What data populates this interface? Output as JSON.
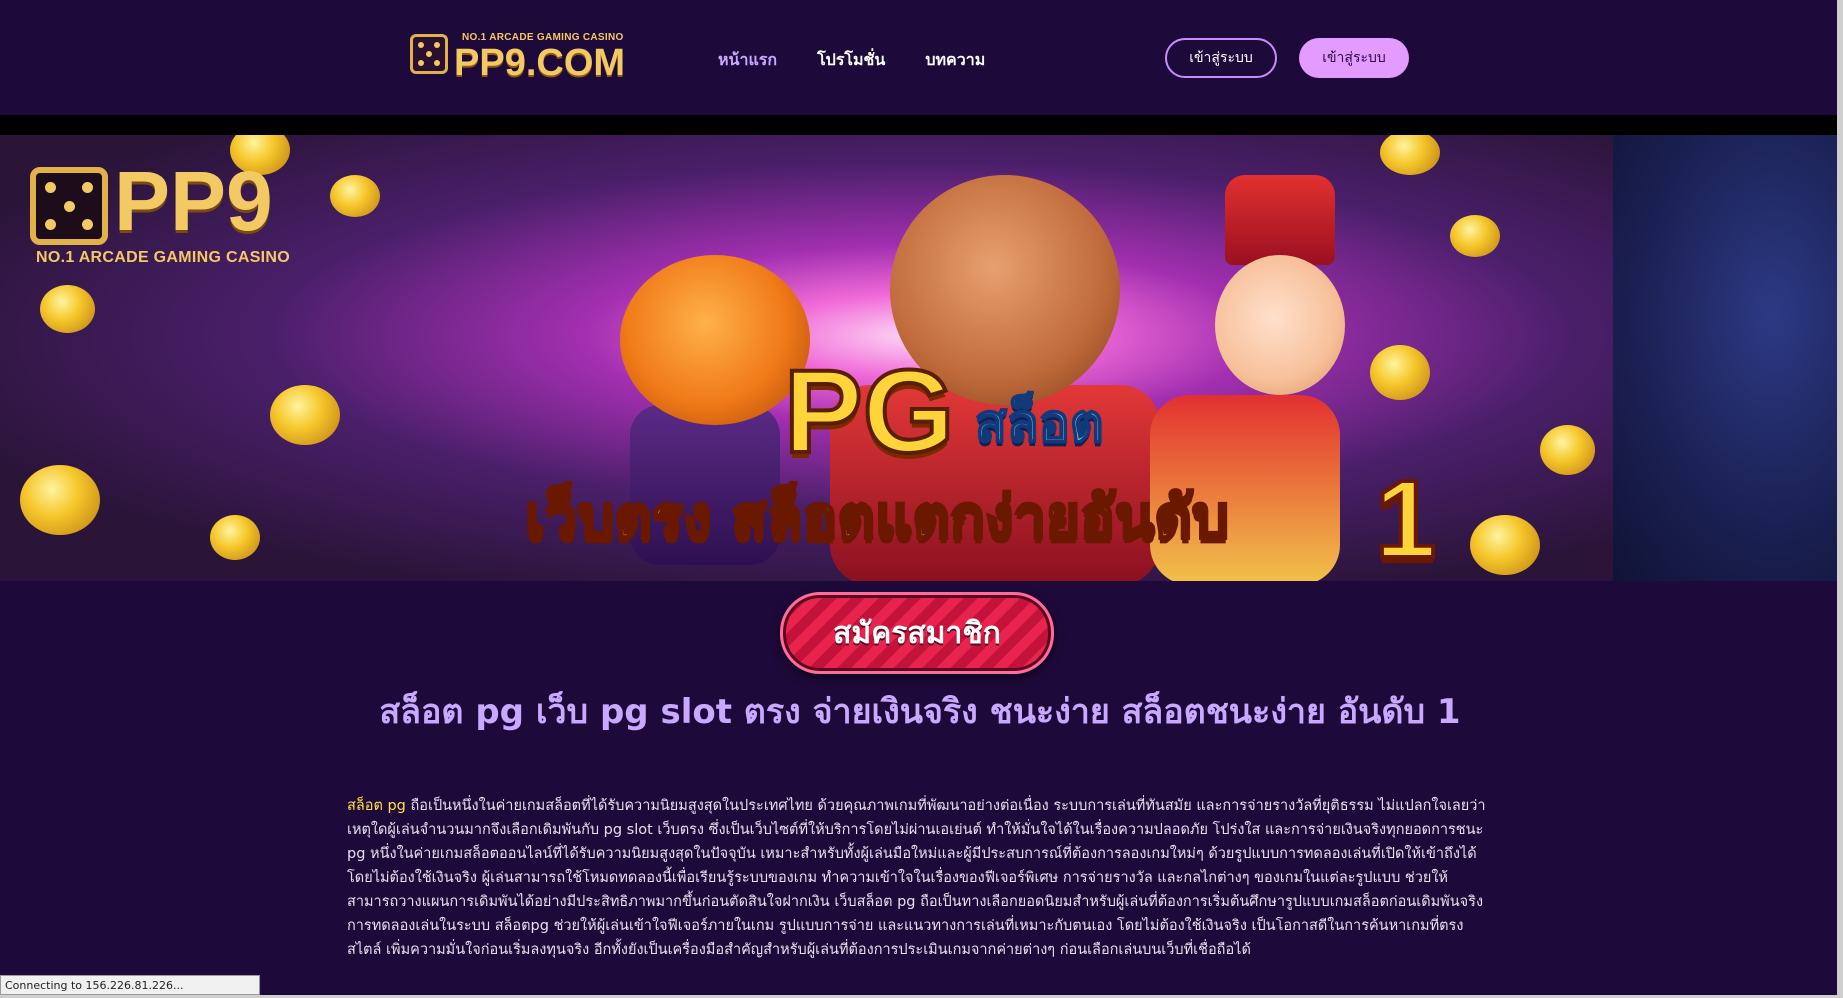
{
  "header": {
    "logo_tagline": "NO.1 ARCADE GAMING CASINO",
    "logo_text": "PP9.COM",
    "nav": [
      {
        "label": "หน้าแรก"
      },
      {
        "label": "โปรโมชั่น"
      },
      {
        "label": "บทความ"
      }
    ],
    "login_label": "เข้าสู่ระบบ",
    "register_top_label": "เข้าสู่ระบบ"
  },
  "banner": {
    "logo_text": "PP9",
    "logo_tagline": "NO.1 ARCADE GAMING CASINO",
    "pg_text": "PG",
    "slot_text": "สล็อต",
    "subtitle": "เว็บตรง สล็อตแตกง่ายอันดับ",
    "number": "1"
  },
  "register_button": "สมัครสมาชิก",
  "main": {
    "heading": "สล็อต pg เว็บ pg slot ตรง จ่ายเงินจริง ชนะง่าย สล็อตชนะง่าย อันดับ 1",
    "keyword": "สล็อต pg",
    "paragraph": " ถือเป็นหนึ่งในค่ายเกมสล็อตที่ได้รับความนิยมสูงสุดในประเทศไทย ด้วยคุณภาพเกมที่พัฒนาอย่างต่อเนื่อง ระบบการเล่นที่ทันสมัย และการจ่ายรางวัลที่ยุติธรรม ไม่แปลกใจเลยว่าเหตุใดผู้เล่นจำนวนมากจึงเลือกเดิมพันกับ pg slot เว็บตรง ซึ่งเป็นเว็บไซต์ที่ให้บริการโดยไม่ผ่านเอเย่นต์ ทำให้มั่นใจได้ในเรื่องความปลอดภัย โปร่งใส และการจ่ายเงินจริงทุกยอดการชนะ pg หนึ่งในค่ายเกมสล็อตออนไลน์ที่ได้รับความนิยมสูงสุดในปัจจุบัน เหมาะสำหรับทั้งผู้เล่นมือใหม่และผู้มีประสบการณ์ที่ต้องการลองเกมใหม่ๆ ด้วยรูปแบบการทดลองเล่นที่เปิดให้เข้าถึงได้โดยไม่ต้องใช้เงินจริง ผู้เล่นสามารถใช้โหมดทดลองนี้เพื่อเรียนรู้ระบบของเกม ทำความเข้าใจในเรื่องของฟีเจอร์พิเศษ การจ่ายรางวัล และกลไกต่างๆ ของเกมในแต่ละรูปแบบ ช่วยให้สามารถวางแผนการเดิมพันได้อย่างมีประสิทธิภาพมากขึ้นก่อนตัดสินใจฝากเงิน เว็บสล็อต pg ถือเป็นทางเลือกยอดนิยมสำหรับผู้เล่นที่ต้องการเริ่มต้นศึกษารูปแบบเกมสล็อตก่อนเดิมพันจริง การทดลองเล่นในระบบ สล็อตpg ช่วยให้ผู้เล่นเข้าใจฟีเจอร์ภายในเกม รูปแบบการจ่าย และแนวทางการเล่นที่เหมาะกับตนเอง โดยไม่ต้องใช้เงินจริง เป็นโอกาสดีในการค้นหาเกมที่ตรงสไตล์ เพิ่มความมั่นใจก่อนเริ่มลงทุนจริง อีกทั้งยังเป็นเครื่องมือสำคัญสำหรับผู้เล่นที่ต้องการประเมินเกมจากค่ายต่างๆ ก่อนเลือกเล่นบนเว็บที่เชื่อถือได้"
  },
  "status_bar": "Connecting to 156.226.81.226...",
  "colors": {
    "background": "#1e0a3a",
    "accent_purple": "#c9a8ff",
    "gold": "#f3c964",
    "keyword_yellow": "#ffe14a",
    "register_red": "#e8234e"
  }
}
